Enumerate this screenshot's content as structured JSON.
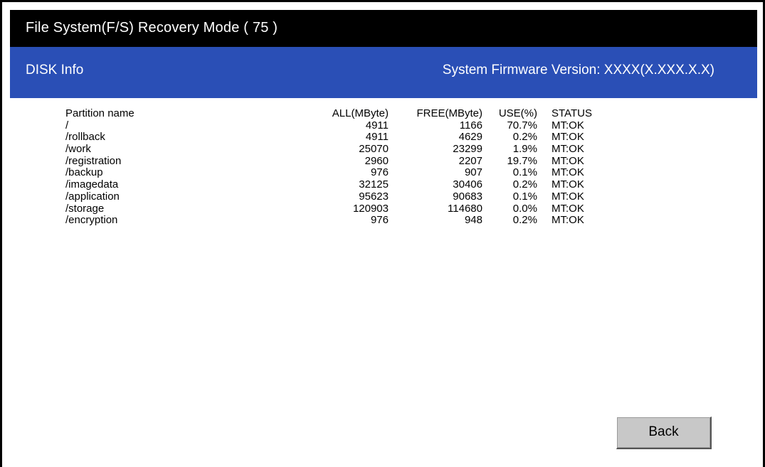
{
  "title_bar": {
    "title": "File System(F/S) Recovery Mode ( 75 )"
  },
  "info_bar": {
    "title": "DISK Info",
    "firmware_version": "System Firmware Version: XXXX(X.XXX.X.X)"
  },
  "table": {
    "headers": {
      "name": "Partition name",
      "all": "ALL(MByte)",
      "free": "FREE(MByte)",
      "use": "USE(%)",
      "status": "STATUS"
    },
    "rows": [
      {
        "name": "/",
        "all": "4911",
        "free": "1166",
        "use": "70.7%",
        "status": "MT:OK"
      },
      {
        "name": "/rollback",
        "all": "4911",
        "free": "4629",
        "use": "0.2%",
        "status": "MT:OK"
      },
      {
        "name": "/work",
        "all": "25070",
        "free": "23299",
        "use": "1.9%",
        "status": "MT:OK"
      },
      {
        "name": "/registration",
        "all": "2960",
        "free": "2207",
        "use": "19.7%",
        "status": "MT:OK"
      },
      {
        "name": "/backup",
        "all": "976",
        "free": "907",
        "use": "0.1%",
        "status": "MT:OK"
      },
      {
        "name": "/imagedata",
        "all": "32125",
        "free": "30406",
        "use": "0.2%",
        "status": "MT:OK"
      },
      {
        "name": "/application",
        "all": "95623",
        "free": "90683",
        "use": "0.1%",
        "status": "MT:OK"
      },
      {
        "name": "/storage",
        "all": "120903",
        "free": "114680",
        "use": "0.0%",
        "status": "MT:OK"
      },
      {
        "name": "/encryption",
        "all": "976",
        "free": "948",
        "use": "0.2%",
        "status": "MT:OK"
      }
    ]
  },
  "buttons": {
    "back_label": "Back"
  },
  "colors": {
    "title_bar_bg": "#000000",
    "info_bar_bg": "#2a4fb6",
    "button_bg": "#c8c8c8"
  }
}
